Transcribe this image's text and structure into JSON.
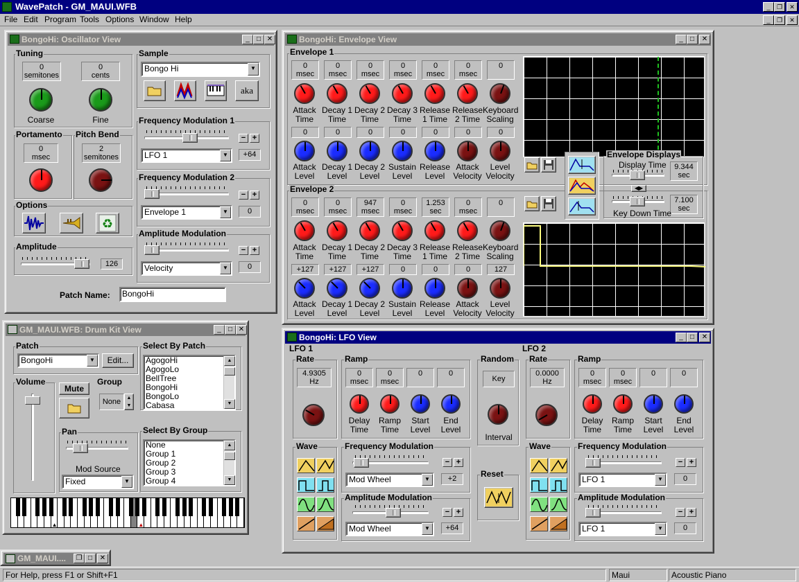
{
  "app": {
    "title": "WavePatch - GM_MAUI.WFB"
  },
  "menu": [
    "File",
    "Edit",
    "Program",
    "Tools",
    "Options",
    "Window",
    "Help"
  ],
  "title_buttons": {
    "minimize": "_",
    "maximize": "□",
    "close": "✕",
    "restore": "❐"
  },
  "osc": {
    "title": "BongoHi: Oscillator View",
    "tuning": {
      "label": "Tuning",
      "semitones": "0",
      "semitones_unit": "semitones",
      "cents": "0",
      "cents_unit": "cents",
      "coarse": "Coarse",
      "fine": "Fine"
    },
    "sample": {
      "label": "Sample",
      "value": "Bongo Hi",
      "aka": "aka"
    },
    "fm1": {
      "label": "Frequency Modulation 1",
      "source": "LFO 1",
      "amount": "+64",
      "level": 0.55
    },
    "fm2": {
      "label": "Frequency Modulation 2",
      "source": "Envelope 1",
      "amount": "0",
      "level": 0.0
    },
    "am": {
      "label": "Amplitude Modulation",
      "source": "Velocity",
      "amount": "0",
      "level": 0.0
    },
    "portamento": {
      "label": "Portamento",
      "value": "0",
      "unit": "msec"
    },
    "pitchbend": {
      "label": "Pitch Bend",
      "value": "2",
      "unit": "semitones"
    },
    "options": {
      "label": "Options"
    },
    "amplitude": {
      "label": "Amplitude",
      "value": "126",
      "level": 0.99
    },
    "patch_name_label": "Patch Name:",
    "patch_name": "BongoHi"
  },
  "env": {
    "title": "BongoHi: Envelope View",
    "env1": {
      "label": "Envelope 1",
      "time_values": [
        {
          "value": "0",
          "unit": "msec"
        },
        {
          "value": "0",
          "unit": "msec"
        },
        {
          "value": "0",
          "unit": "msec"
        },
        {
          "value": "0",
          "unit": "msec"
        },
        {
          "value": "0",
          "unit": "msec"
        },
        {
          "value": "0",
          "unit": "msec"
        },
        {
          "value": "0",
          "unit": ""
        }
      ],
      "time_labels": [
        [
          "Attack",
          "Time"
        ],
        [
          "Decay 1",
          "Time"
        ],
        [
          "Decay 2",
          "Time"
        ],
        [
          "Decay 3",
          "Time"
        ],
        [
          "Release",
          "1 Time"
        ],
        [
          "Release",
          "2 Time"
        ],
        [
          "Keyboard",
          "Scaling"
        ]
      ],
      "level_values": [
        "0",
        "0",
        "0",
        "0",
        "0",
        "0",
        "0"
      ],
      "level_labels": [
        [
          "Attack",
          "Level"
        ],
        [
          "Decay 1",
          "Level"
        ],
        [
          "Decay 2",
          "Level"
        ],
        [
          "Sustain",
          "Level"
        ],
        [
          "Release",
          "Level"
        ],
        [
          "Attack",
          "Velocity"
        ],
        [
          "Level",
          "Velocity"
        ]
      ]
    },
    "env2": {
      "label": "Envelope 2",
      "time_values": [
        {
          "value": "0",
          "unit": "msec"
        },
        {
          "value": "0",
          "unit": "msec"
        },
        {
          "value": "947",
          "unit": "msec"
        },
        {
          "value": "0",
          "unit": "msec"
        },
        {
          "value": "1.253",
          "unit": "sec"
        },
        {
          "value": "0",
          "unit": "msec"
        },
        {
          "value": "0",
          "unit": ""
        }
      ],
      "time_labels": [
        [
          "Attack",
          "Time"
        ],
        [
          "Decay 1",
          "Time"
        ],
        [
          "Decay 2",
          "Time"
        ],
        [
          "Decay 3",
          "Time"
        ],
        [
          "Release",
          "1 Time"
        ],
        [
          "Release",
          "2 Time"
        ],
        [
          "Keyboard",
          "Scaling"
        ]
      ],
      "level_values": [
        "+127",
        "+127",
        "+127",
        "0",
        "0",
        "0",
        "127"
      ],
      "level_labels": [
        [
          "Attack",
          "Level"
        ],
        [
          "Decay 1",
          "Level"
        ],
        [
          "Decay 2",
          "Level"
        ],
        [
          "Sustain",
          "Level"
        ],
        [
          "Release",
          "Level"
        ],
        [
          "Attack",
          "Velocity"
        ],
        [
          "Level",
          "Velocity"
        ]
      ]
    },
    "displays": {
      "label": "Envelope Displays",
      "display_time_label": "Display Time",
      "display_time": "9.344",
      "display_time_unit": "sec",
      "key_down_label": "Key Down Time",
      "key_down": "7.100",
      "key_down_unit": "sec"
    }
  },
  "drum": {
    "title": "GM_MAUI.WFB: Drum Kit View",
    "patch_label": "Patch",
    "patch_value": "BongoHi",
    "edit": "Edit...",
    "select_by_patch_label": "Select By Patch",
    "patch_list": [
      "AgogoHi",
      "AgogoLo",
      "BellTree",
      "BongoHi",
      "BongoLo",
      "Cabasa"
    ],
    "volume_label": "Volume",
    "mute": "Mute",
    "group_label": "Group",
    "group_value": "None",
    "select_by_group_label": "Select By Group",
    "group_list": [
      "None",
      "Group 1",
      "Group 2",
      "Group 3",
      "Group 4"
    ],
    "pan_label": "Pan",
    "mod_source_label": "Mod Source",
    "mod_source": "Fixed"
  },
  "lfo": {
    "title": "BongoHi: LFO View",
    "lfo1": {
      "label": "LFO 1",
      "rate_label": "Rate",
      "rate": "4.9305",
      "rate_unit": "Hz",
      "ramp_label": "Ramp",
      "ramp_values": [
        {
          "value": "0",
          "unit": "msec"
        },
        {
          "value": "0",
          "unit": "msec"
        },
        {
          "value": "0",
          "unit": ""
        },
        {
          "value": "0",
          "unit": ""
        }
      ],
      "ramp_labels": [
        [
          "Delay",
          "Time"
        ],
        [
          "Ramp",
          "Time"
        ],
        [
          "Start",
          "Level"
        ],
        [
          "End",
          "Level"
        ]
      ],
      "wave_label": "Wave",
      "fm_label": "Frequency Modulation",
      "fm_source": "Mod Wheel",
      "fm_amount": "+2",
      "fm_level": 0.02,
      "am_label": "Amplitude Modulation",
      "am_source": "Mod Wheel",
      "am_amount": "+64",
      "am_level": 0.55
    },
    "lfo2": {
      "label": "LFO 2",
      "rate_label": "Rate",
      "rate": "0.0000",
      "rate_unit": "Hz",
      "ramp_label": "Ramp",
      "ramp_values": [
        {
          "value": "0",
          "unit": "msec"
        },
        {
          "value": "0",
          "unit": "msec"
        },
        {
          "value": "0",
          "unit": ""
        },
        {
          "value": "0",
          "unit": ""
        }
      ],
      "ramp_labels": [
        [
          "Delay",
          "Time"
        ],
        [
          "Ramp",
          "Time"
        ],
        [
          "Start",
          "Level"
        ],
        [
          "End",
          "Level"
        ]
      ],
      "wave_label": "Wave",
      "fm_label": "Frequency Modulation",
      "fm_source": "LFO 1",
      "fm_amount": "0",
      "fm_level": 0.0,
      "am_label": "Amplitude Modulation",
      "am_source": "LFO 1",
      "am_amount": "0",
      "am_level": 0.0
    },
    "random_label": "Random",
    "key": "Key",
    "interval": "Interval",
    "reset_label": "Reset"
  },
  "minimized": {
    "title": "GM_MAUI...."
  },
  "statusbar": {
    "help": "For Help, press F1 or Shift+F1",
    "device": "Maui",
    "patch": "Acoustic Piano"
  },
  "colors": {
    "title_active": "#000080",
    "title_inactive": "#808080",
    "knob_red": "#ff1a1a",
    "knob_blue": "#1a2cff",
    "knob_dark": "#7a1212",
    "knob_green": "#1a9a1a"
  }
}
